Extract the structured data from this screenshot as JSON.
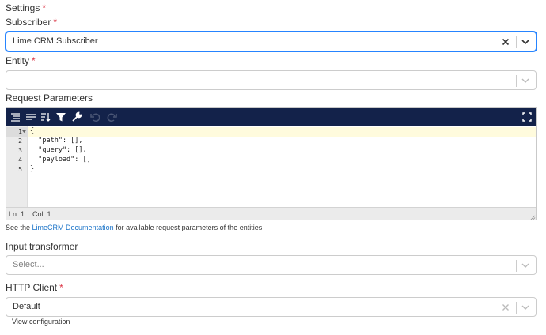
{
  "settings": {
    "label": "Settings",
    "required_mark": "*"
  },
  "subscriber": {
    "label": "Subscriber",
    "required_mark": "*",
    "value": "Lime CRM Subscriber"
  },
  "entity": {
    "label": "Entity",
    "required_mark": "*",
    "value": ""
  },
  "request_parameters": {
    "label": "Request Parameters",
    "toolbar_icons": [
      "format-icon",
      "compact-icon",
      "sort-icon",
      "filter-icon",
      "wrench-icon",
      "undo-icon",
      "redo-icon",
      "fullscreen-icon"
    ],
    "line_numbers": [
      "1",
      "2",
      "3",
      "4",
      "5"
    ],
    "code_lines": [
      "{",
      "  \"path\": [],",
      "  \"query\": [],",
      "  \"payload\": []",
      "}"
    ],
    "status_line": "Ln: 1",
    "status_col": "Col: 1"
  },
  "help": {
    "prefix": "See the",
    "link": "LimeCRM Documentation",
    "suffix": "for available request parameters of the entities"
  },
  "input_transformer": {
    "label": "Input transformer",
    "placeholder": "Select..."
  },
  "http_client": {
    "label": "HTTP Client",
    "required_mark": "*",
    "value": "Default",
    "view_config": "View configuration"
  },
  "colors": {
    "required": "#dc3545",
    "toolbar_bg": "#13224a",
    "focus_border": "#2684ff",
    "link": "#1a73c8",
    "active_line": "#fffbdd"
  }
}
